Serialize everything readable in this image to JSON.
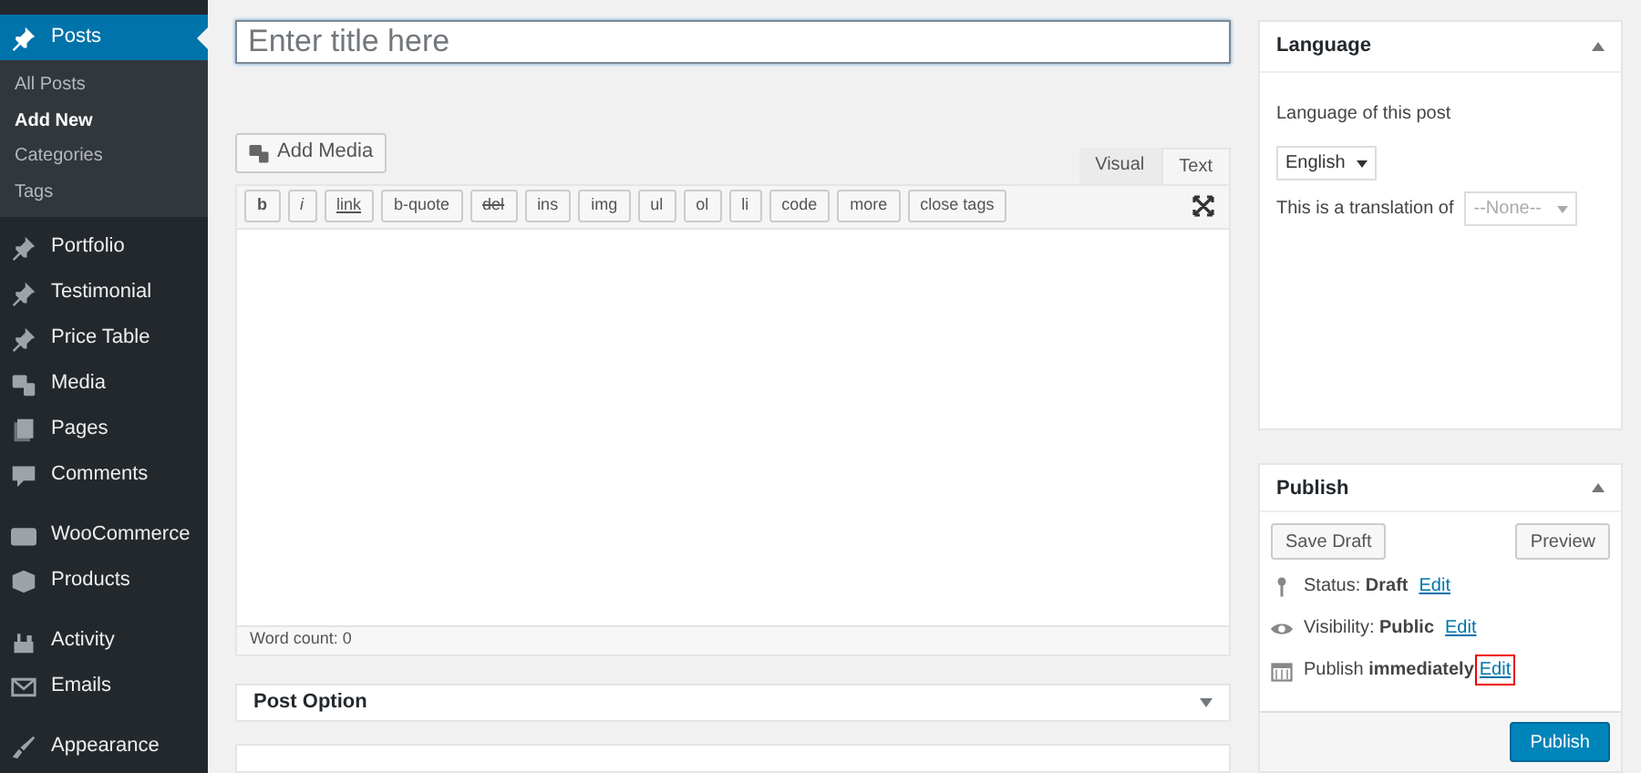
{
  "sidebar": {
    "items": [
      {
        "label": "Posts",
        "kind": "pin",
        "selected": true,
        "children": [
          {
            "label": "All Posts",
            "selected": false
          },
          {
            "label": "Add New",
            "selected": true
          },
          {
            "label": "Categories",
            "selected": false
          },
          {
            "label": "Tags",
            "selected": false
          }
        ]
      },
      {
        "label": "Portfolio",
        "kind": "pin",
        "selected": false
      },
      {
        "label": "Testimonial",
        "kind": "pin",
        "selected": false
      },
      {
        "label": "Price Table",
        "kind": "pin",
        "selected": false
      },
      {
        "label": "Media",
        "kind": "media",
        "selected": false
      },
      {
        "label": "Pages",
        "kind": "pages",
        "selected": false
      },
      {
        "label": "Comments",
        "kind": "comments",
        "selected": false
      },
      {
        "label": "WooCommerce",
        "kind": "woo",
        "selected": false
      },
      {
        "label": "Products",
        "kind": "products",
        "selected": false
      },
      {
        "label": "Activity",
        "kind": "activity",
        "selected": false
      },
      {
        "label": "Emails",
        "kind": "emails",
        "selected": false
      },
      {
        "label": "Appearance",
        "kind": "appearance",
        "selected": false
      }
    ]
  },
  "title_field": {
    "placeholder": "Enter title here"
  },
  "add_media": "Add Media",
  "editor_tabs": [
    {
      "label": "Visual",
      "selected": false
    },
    {
      "label": "Text",
      "selected": true
    }
  ],
  "quicktags": [
    {
      "label": "b",
      "kind": "bold"
    },
    {
      "label": "i",
      "kind": "italic"
    },
    {
      "label": "link",
      "kind": "underline"
    },
    {
      "label": "b-quote",
      "kind": "plain"
    },
    {
      "label": "del",
      "kind": "strike"
    },
    {
      "label": "ins",
      "kind": "plain"
    },
    {
      "label": "img",
      "kind": "plain"
    },
    {
      "label": "ul",
      "kind": "plain"
    },
    {
      "label": "ol",
      "kind": "plain"
    },
    {
      "label": "li",
      "kind": "plain"
    },
    {
      "label": "code",
      "kind": "plain"
    },
    {
      "label": "more",
      "kind": "plain"
    },
    {
      "label": "close tags",
      "kind": "plain"
    }
  ],
  "word_count": "Word count: 0",
  "post_option": {
    "title": "Post Option",
    "expanded": false
  },
  "language_box": {
    "title": "Language",
    "expanded": true,
    "label": "Language of this post",
    "language": "English",
    "translation_label": "This is a translation of",
    "translation": "--None--"
  },
  "publish_box": {
    "title": "Publish",
    "expanded": true,
    "save_draft": "Save Draft",
    "preview": "Preview",
    "rows": [
      {
        "kind": "key",
        "label": "Status:",
        "value": "Draft",
        "link": "Edit",
        "highlighted": false
      },
      {
        "kind": "eye",
        "label": "Visibility:",
        "value": "Public",
        "link": "Edit",
        "highlighted": false
      },
      {
        "kind": "calendar",
        "label": "Publish",
        "value": "immediately",
        "link": "Edit",
        "highlighted": true
      }
    ],
    "publish": "Publish"
  }
}
